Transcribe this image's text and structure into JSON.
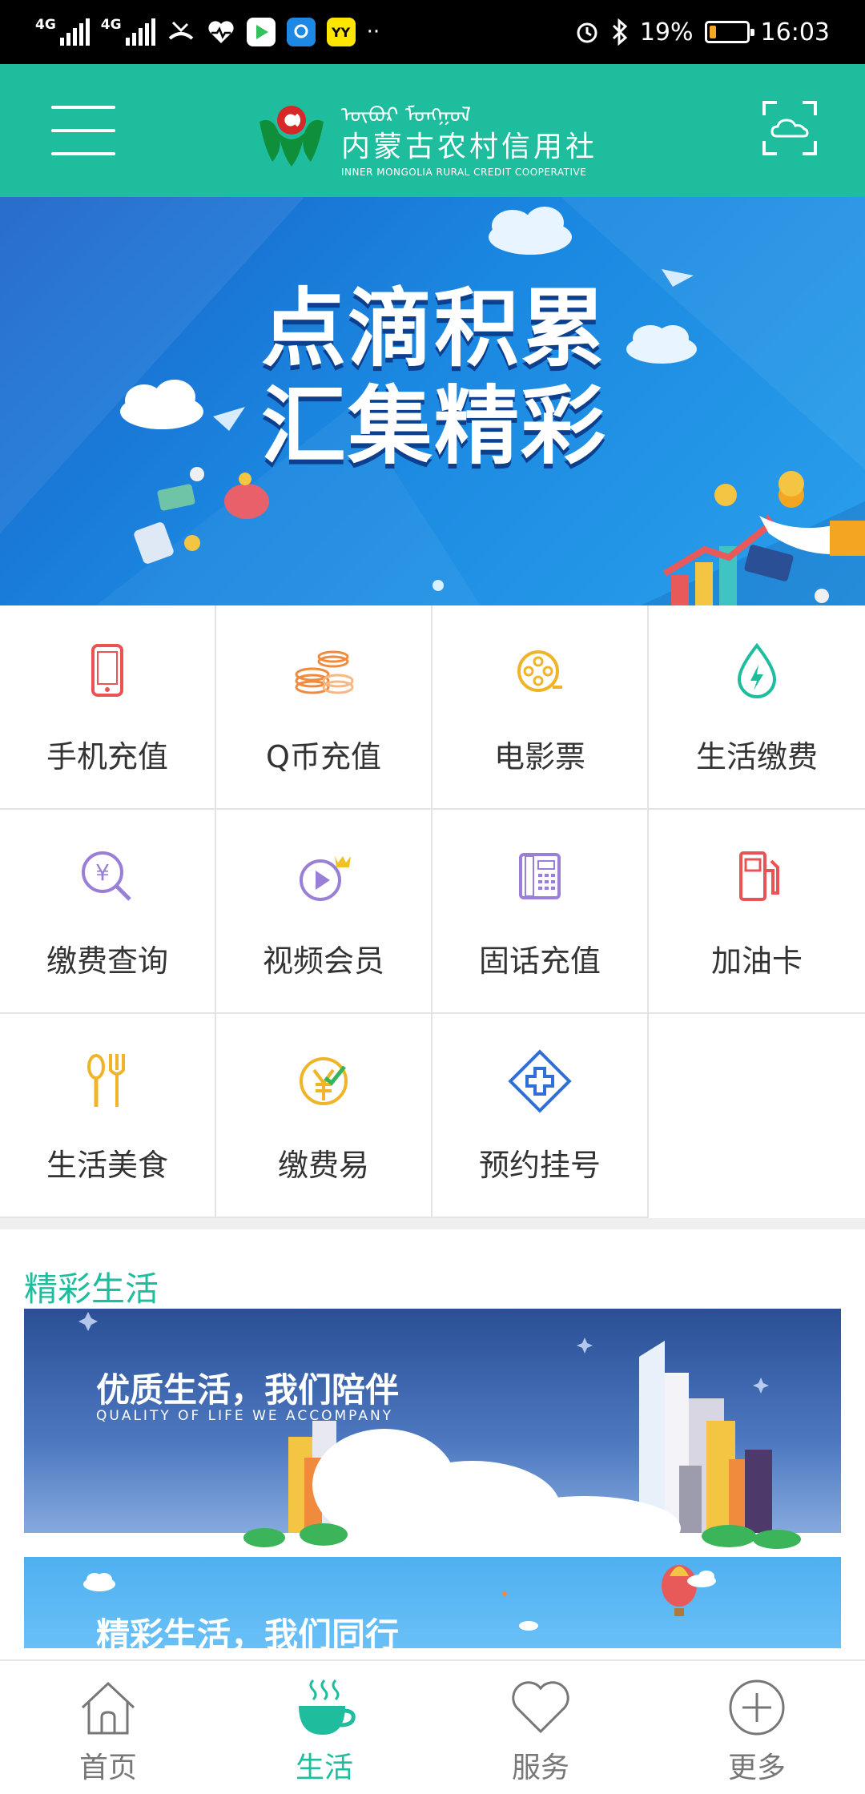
{
  "status_bar": {
    "network_1": "4G",
    "network_2": "4G",
    "battery": "19%",
    "battery_level": 0.19,
    "time": "16:03",
    "app_badge_yy": "YY"
  },
  "header": {
    "logo_mongolian": "ᠥᠪᠥᠷ ᠮᠣᠩᠭᠣᠯ",
    "logo_cn": "内蒙古农村信用社",
    "logo_en": "INNER MONGOLIA RURAL CREDIT COOPERATIVE"
  },
  "banner": {
    "title_line1": "点滴积累",
    "title_line2": "汇集精彩"
  },
  "services": [
    {
      "label": "手机充值",
      "icon": "phone-icon"
    },
    {
      "label": "Q币充值",
      "icon": "coins-icon"
    },
    {
      "label": "电影票",
      "icon": "film-reel-icon"
    },
    {
      "label": "生活缴费",
      "icon": "water-drop-icon"
    },
    {
      "label": "缴费查询",
      "icon": "yuan-search-icon"
    },
    {
      "label": "视频会员",
      "icon": "video-play-icon"
    },
    {
      "label": "固话充值",
      "icon": "landline-phone-icon"
    },
    {
      "label": "加油卡",
      "icon": "fuel-pump-icon"
    },
    {
      "label": "生活美食",
      "icon": "spoon-fork-icon"
    },
    {
      "label": "缴费易",
      "icon": "yuan-check-icon"
    },
    {
      "label": "预约挂号",
      "icon": "medical-cross-icon"
    }
  ],
  "section": {
    "title": "精彩生活",
    "card1_title": "优质生活，我们陪伴",
    "card1_subtitle": "QUALITY OF LIFE WE ACCOMPANY",
    "card2_title": "精彩生活，我们同行"
  },
  "bottom_nav": [
    {
      "label": "首页",
      "icon": "home-icon"
    },
    {
      "label": "生活",
      "icon": "coffee-cup-icon",
      "active": true
    },
    {
      "label": "服务",
      "icon": "heart-icon"
    },
    {
      "label": "更多",
      "icon": "plus-circle-icon"
    }
  ],
  "colors": {
    "brand": "#1ebd9e",
    "status_bar": "#000000",
    "battery": "#f5a623"
  }
}
